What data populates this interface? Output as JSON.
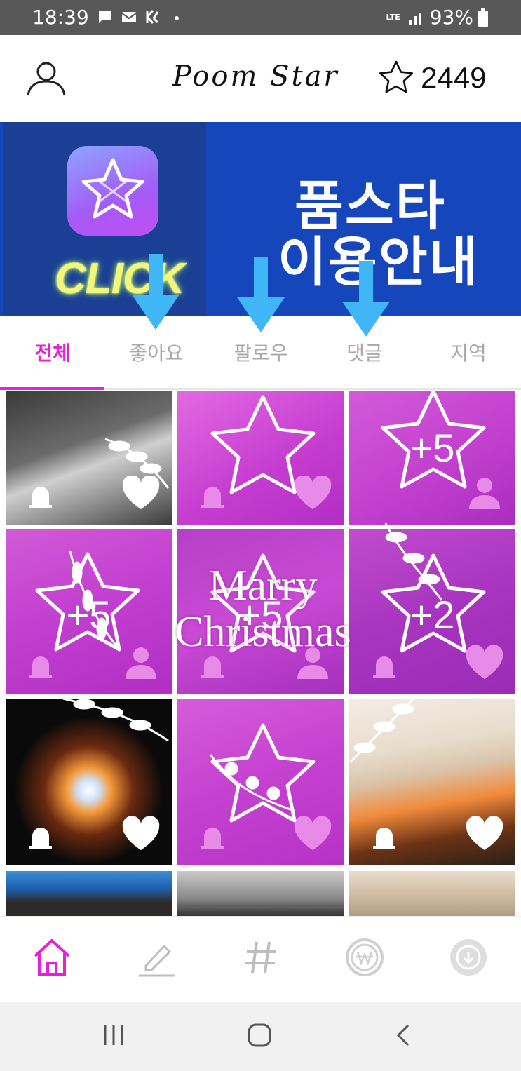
{
  "status_bar": {
    "time": "18:39",
    "network": "LTE",
    "battery": "93%",
    "left_icons": [
      "chat-icon",
      "naver-mail-icon",
      "kakao-icon",
      "dot-icon"
    ],
    "right_icons": [
      "signal-icon",
      "battery-icon"
    ]
  },
  "header": {
    "profile_icon": "user-icon",
    "app_title": "Poom Star",
    "star_icon": "star-outline-icon",
    "star_count": "2449"
  },
  "banner": {
    "click_text": "CLICK",
    "title_line1": "품스타",
    "title_line2": "이용안내",
    "colors": {
      "background": "#1646bc",
      "left_panel": "#1a3f95",
      "click_glow": "#b8ff55"
    }
  },
  "tabs": {
    "items": [
      "전체",
      "좋아요",
      "팔로우",
      "댓글",
      "지역"
    ],
    "active_index": 0,
    "active_color": "#e81fd9"
  },
  "grid": {
    "overlay_text_line1": "Marry",
    "overlay_text_line2": "Christmas",
    "cells": [
      {
        "plus_label": "",
        "right_icon": "heart-icon"
      },
      {
        "plus_label": "",
        "right_icon": "heart-icon"
      },
      {
        "plus_label": "+5",
        "right_icon": "person-icon"
      },
      {
        "plus_label": "+5",
        "right_icon": "person-icon"
      },
      {
        "plus_label": "+5",
        "right_icon": "person-icon"
      },
      {
        "plus_label": "+2",
        "right_icon": "heart-icon"
      },
      {
        "plus_label": "",
        "right_icon": "heart-icon"
      },
      {
        "plus_label": "",
        "right_icon": "heart-icon"
      },
      {
        "plus_label": "",
        "right_icon": "heart-icon"
      }
    ]
  },
  "bottom_nav": {
    "items": [
      "home-icon",
      "pencil-icon",
      "hashtag-icon",
      "won-coin-icon",
      "download-icon"
    ],
    "active_color": "#e81fd9"
  },
  "system_nav": {
    "items": [
      "recent-apps-icon",
      "home-button-icon",
      "back-icon"
    ]
  }
}
